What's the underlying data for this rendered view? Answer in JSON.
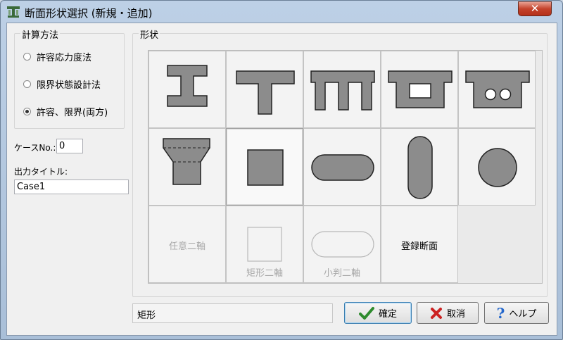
{
  "window": {
    "title": "断面形状選択 (新規・追加)",
    "close_label": "✕"
  },
  "calc_group": {
    "title": "計算方法",
    "options": [
      {
        "label": "許容応力度法",
        "checked": false
      },
      {
        "label": "限界状態設計法",
        "checked": false
      },
      {
        "label": "許容、限界(両方)",
        "checked": true
      }
    ]
  },
  "case_no": {
    "label": "ケースNo.:",
    "value": "0"
  },
  "output_title": {
    "label": "出力タイトル:",
    "value": "Case1"
  },
  "shape_group": {
    "title": "形状"
  },
  "shapes": [
    {
      "id": "i-section",
      "label": ""
    },
    {
      "id": "t-section",
      "label": ""
    },
    {
      "id": "pi-section",
      "label": ""
    },
    {
      "id": "box-section",
      "label": ""
    },
    {
      "id": "hollow-slab-section",
      "label": ""
    },
    {
      "id": "tapered-section",
      "label": ""
    },
    {
      "id": "rectangle-section",
      "label": "",
      "selected": true
    },
    {
      "id": "horizontal-oval-section",
      "label": ""
    },
    {
      "id": "vertical-oval-section",
      "label": ""
    },
    {
      "id": "circle-section",
      "label": ""
    },
    {
      "id": "arbitrary-biaxial",
      "label": "任意二軸",
      "disabled": true
    },
    {
      "id": "rectangle-biaxial",
      "label": "矩形二軸",
      "disabled": true
    },
    {
      "id": "oval-biaxial",
      "label": "小判二軸",
      "disabled": true
    },
    {
      "id": "registered-section",
      "label": "登録断面",
      "disabled": false
    }
  ],
  "status_text": "矩形",
  "buttons": {
    "ok": "確定",
    "cancel": "取消",
    "help": "ヘルプ"
  },
  "colors": {
    "shape_fill": "#8c8c8c",
    "disabled_text": "#a8a8a8",
    "ok_icon": "#2e8b2e",
    "cancel_icon": "#cc2222",
    "help_icon": "#2266cc"
  }
}
